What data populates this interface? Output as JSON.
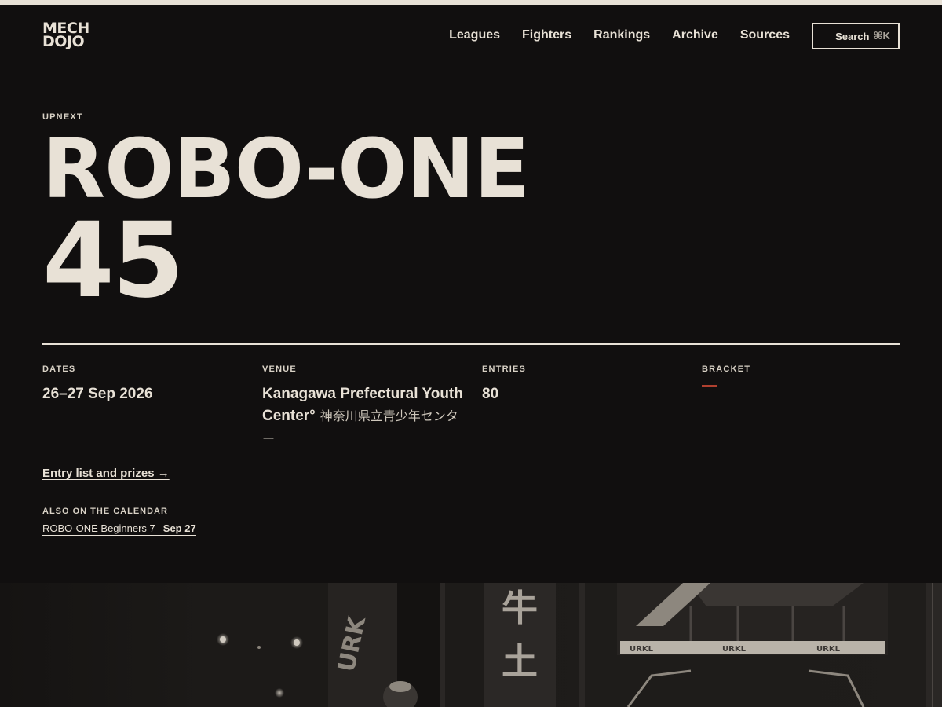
{
  "brand": {
    "line1": "MECH",
    "line2": "DOJO"
  },
  "nav": {
    "items": [
      "Leagues",
      "Fighters",
      "Rankings",
      "Archive",
      "Sources"
    ]
  },
  "search": {
    "label": "Search",
    "shortcut": "⌘K"
  },
  "event": {
    "eyebrow": "UPNEXT",
    "title_line1": "ROBO-ONE",
    "title_line2": "45",
    "dates_label": "DATES",
    "dates_value": "26–27 Sep 2026",
    "venue_label": "VENUE",
    "venue_value": "Kanagawa Prefectural Youth Center°",
    "venue_jp": "神奈川県立青少年センター",
    "entries_label": "ENTRIES",
    "entries_value": "80",
    "bracket_label": "BRACKET",
    "entry_link": "Entry list and prizes →"
  },
  "calendar": {
    "label": "ALSO ON THE CALENDAR",
    "items": [
      {
        "name": "ROBO-ONE Beginners 7",
        "date": "Sep 27"
      }
    ]
  },
  "colors": {
    "background": "#110f0f",
    "foreground": "#e8e1d6",
    "accent_red": "#b0402f"
  },
  "photo": {
    "banner_kanji_1": "牛",
    "banner_kanji_2": "土",
    "banner_text": "URKL"
  }
}
